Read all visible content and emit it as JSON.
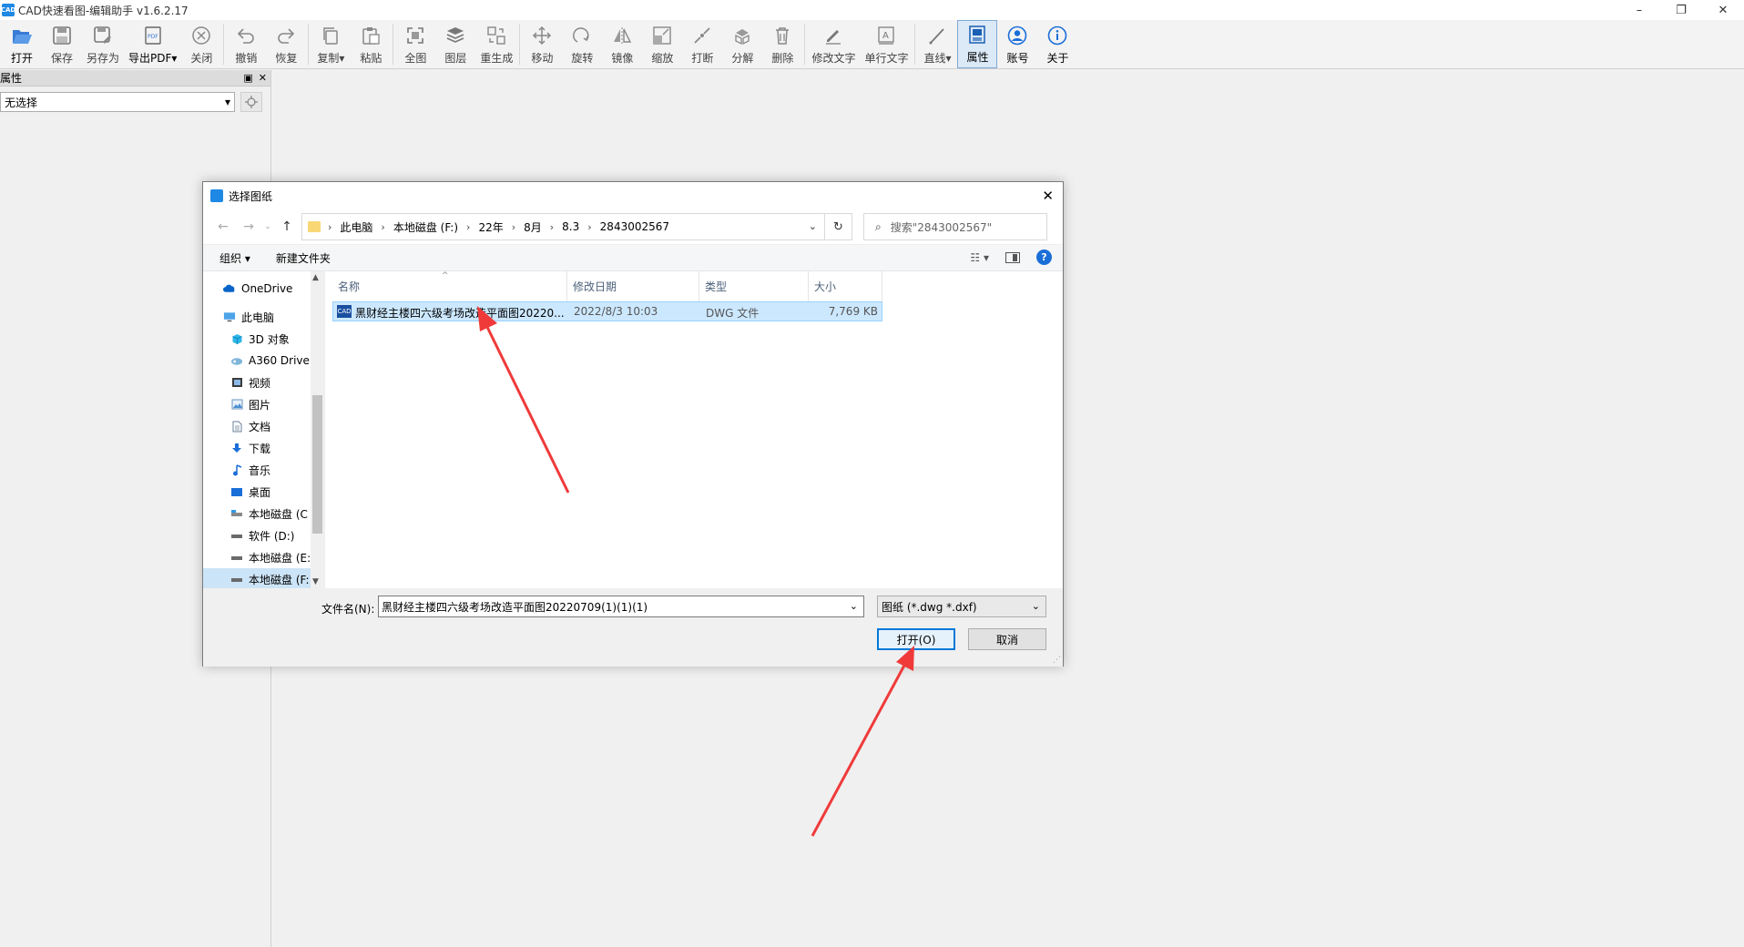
{
  "window": {
    "title": "CAD快速看图-编辑助手 v1.6.2.17",
    "minimize": "–",
    "restore": "❐",
    "close": "✕"
  },
  "toolbar": {
    "items": [
      {
        "id": "open",
        "label": "打开"
      },
      {
        "id": "save",
        "label": "保存"
      },
      {
        "id": "save-as",
        "label": "另存为"
      },
      {
        "id": "export-pdf",
        "label": "导出PDF▾"
      },
      {
        "id": "close",
        "label": "关闭"
      },
      {
        "id": "undo",
        "label": "撤销"
      },
      {
        "id": "redo",
        "label": "恢复"
      },
      {
        "id": "copy",
        "label": "复制▾"
      },
      {
        "id": "paste",
        "label": "粘贴"
      },
      {
        "id": "full-view",
        "label": "全图"
      },
      {
        "id": "layer",
        "label": "图层"
      },
      {
        "id": "regen",
        "label": "重生成"
      },
      {
        "id": "move",
        "label": "移动"
      },
      {
        "id": "rotate",
        "label": "旋转"
      },
      {
        "id": "mirror",
        "label": "镜像"
      },
      {
        "id": "scale",
        "label": "缩放"
      },
      {
        "id": "break",
        "label": "打断"
      },
      {
        "id": "explode",
        "label": "分解"
      },
      {
        "id": "delete",
        "label": "删除"
      },
      {
        "id": "edit-text",
        "label": "修改文字"
      },
      {
        "id": "single-text",
        "label": "单行文字"
      },
      {
        "id": "line",
        "label": "直线▾"
      },
      {
        "id": "properties",
        "label": "属性"
      },
      {
        "id": "account",
        "label": "账号"
      },
      {
        "id": "about",
        "label": "关于"
      }
    ]
  },
  "props_panel": {
    "title": "属性",
    "pin": "▣",
    "close": "✕",
    "selection": "无选择",
    "dropdown": "▾"
  },
  "dialog": {
    "title": "选择图纸",
    "close": "✕",
    "breadcrumbs": [
      "此电脑",
      "本地磁盘 (F:)",
      "22年",
      "8月",
      "8.3",
      "2843002567"
    ],
    "search_placeholder": "搜索\"2843002567\"",
    "organize": "组织 ▾",
    "new_folder": "新建文件夹",
    "help": "?",
    "tree": [
      {
        "label": "OneDrive",
        "icon": "cloud-icon"
      },
      {
        "label": "此电脑",
        "icon": "computer-icon"
      },
      {
        "label": "3D 对象",
        "icon": "cube-icon"
      },
      {
        "label": "A360 Drive",
        "icon": "drive-icon"
      },
      {
        "label": "视频",
        "icon": "video-icon"
      },
      {
        "label": "图片",
        "icon": "picture-icon"
      },
      {
        "label": "文档",
        "icon": "document-icon"
      },
      {
        "label": "下载",
        "icon": "download-icon"
      },
      {
        "label": "音乐",
        "icon": "music-icon"
      },
      {
        "label": "桌面",
        "icon": "desktop-icon"
      },
      {
        "label": "本地磁盘 (C",
        "icon": "disk-icon"
      },
      {
        "label": "软件 (D:)",
        "icon": "disk-icon"
      },
      {
        "label": "本地磁盘 (E:",
        "icon": "disk-icon"
      },
      {
        "label": "本地磁盘 (F:",
        "icon": "disk-icon"
      }
    ],
    "columns": [
      "名称",
      "修改日期",
      "类型",
      "大小"
    ],
    "files": [
      {
        "name": "黑财经主楼四六级考场改造平面图20220...",
        "date": "2022/8/3 10:03",
        "type": "DWG 文件",
        "size": "7,769 KB"
      }
    ],
    "filename_label": "文件名(N):",
    "filename_value": "黑财经主楼四六级考场改造平面图20220709(1)(1)(1)",
    "filter": "图纸 (*.dwg *.dxf)",
    "open_button": "打开(O)",
    "cancel_button": "取消"
  }
}
